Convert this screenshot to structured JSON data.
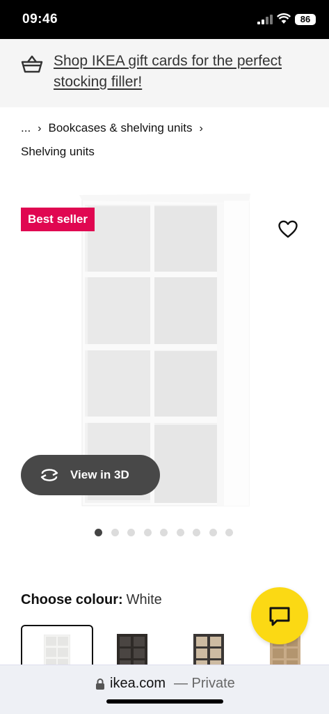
{
  "status_bar": {
    "time": "09:46",
    "battery": "86"
  },
  "promo": {
    "text": "Shop IKEA gift cards for the perfect stocking filler!"
  },
  "breadcrumb": {
    "ellipsis": "...",
    "separator": "›",
    "category": "Bookcases & shelving units",
    "current": "Shelving units"
  },
  "product": {
    "badge": "Best seller",
    "view_3d_label": "View in 3D"
  },
  "gallery": {
    "image_count": 9,
    "active_index": 0
  },
  "colour": {
    "label": "Choose colour:",
    "value": "White"
  },
  "swatches": [
    {
      "name": "white",
      "color": "#f4f4f2"
    },
    {
      "name": "black-brown",
      "color": "#2e2a27"
    },
    {
      "name": "white-stained-oak",
      "color": "#cdbba2"
    },
    {
      "name": "oak",
      "color": "#c8ab88"
    }
  ],
  "browser": {
    "domain": "ikea.com",
    "private_label": "— Private"
  },
  "colors": {
    "badge": "#e00751",
    "chat_button": "#fbd914",
    "view3d_button": "#484848"
  },
  "icons": {
    "promo": "basket-icon",
    "wishlist": "heart-icon",
    "view3d": "rotate-3d-icon",
    "chat": "chat-icon",
    "lock": "lock-icon"
  }
}
